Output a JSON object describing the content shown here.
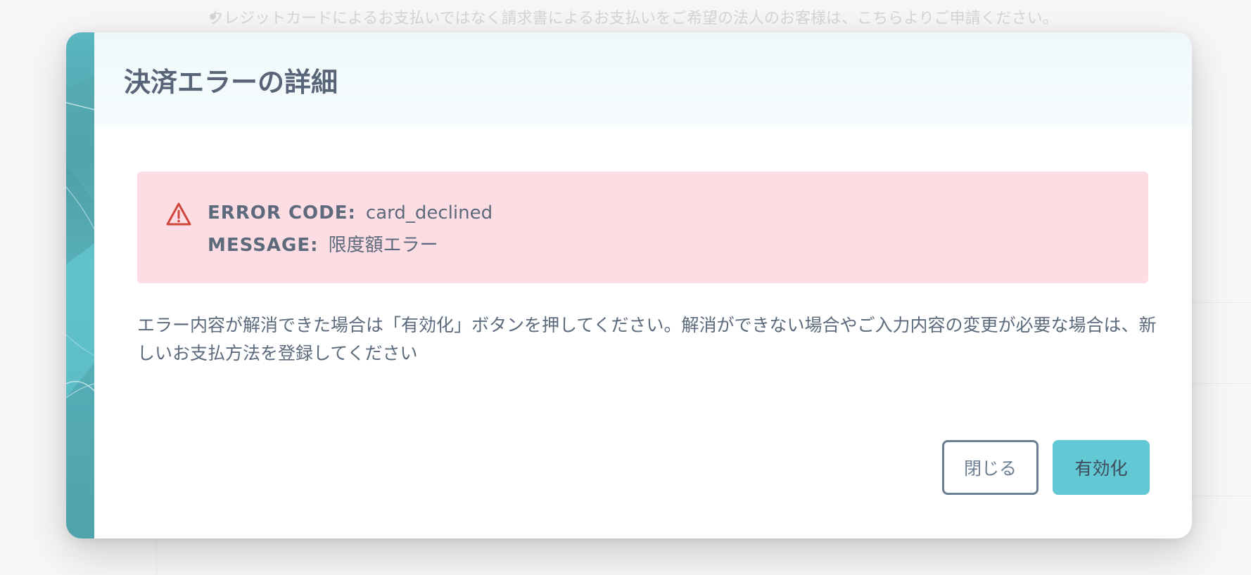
{
  "background": {
    "note": "クレジットカードによるお支払いではなく請求書によるお支払いをご希望の法人のお客様は、こちらよりご申請ください。"
  },
  "modal": {
    "title": "決済エラーの詳細",
    "error": {
      "code_label": "ERROR CODE:",
      "code_value": "card_declined",
      "message_label": "MESSAGE:",
      "message_value": "限度額エラー",
      "icon": "warning-triangle-icon"
    },
    "description": "エラー内容が解消できた場合は「有効化」ボタンを押してください。解消ができない場合やご入力内容の変更が必要な場合は、新しいお支払方法を登録してください",
    "buttons": {
      "close_label": "閉じる",
      "enable_label": "有効化"
    }
  },
  "colors": {
    "accent": "#62c8d3",
    "error_bg": "#fbdde3",
    "error_icon": "#d0463b",
    "text": "#5b6a7c"
  }
}
